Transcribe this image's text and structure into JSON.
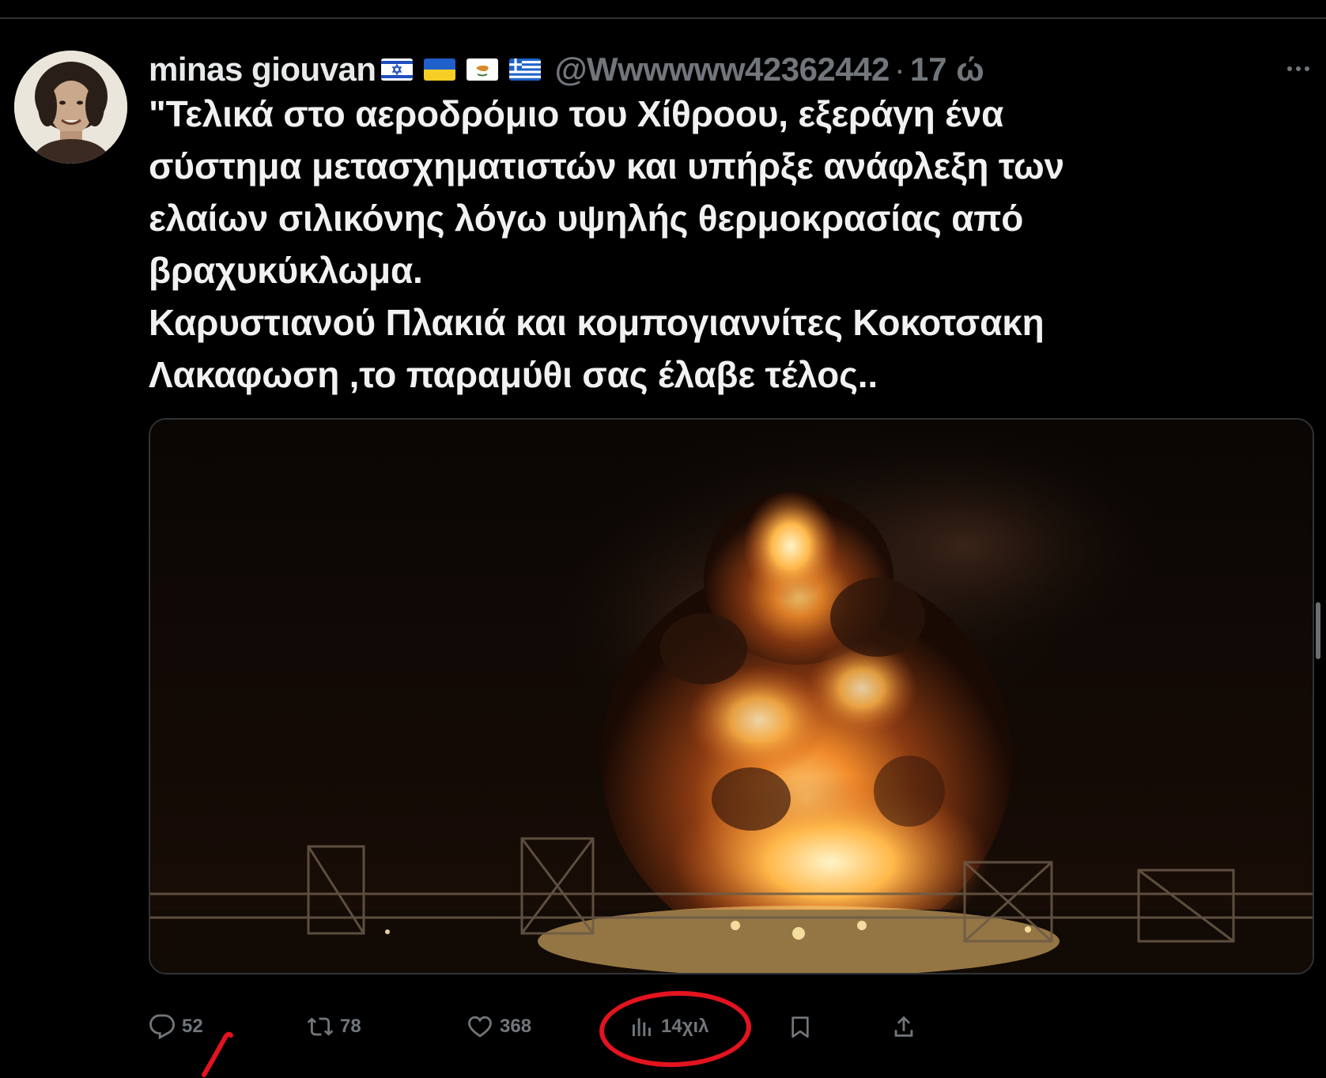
{
  "tweet": {
    "display_name": "minas giouvan",
    "flags": [
      "israel-flag",
      "ukraine-flag",
      "cyprus-flag",
      "greece-flag"
    ],
    "handle": "@Wwwwww42362442",
    "separator": "·",
    "timestamp": "17 ώ",
    "text": "\"Τελικά στο αεροδρόμιο του Χίθροου, εξεράγη ένα\nσύστημα μετασχηματιστών και υπήρξε ανάφλεξη των\nελαίων σιλικόνης λόγω υψηλής θερμοκρασίας από\nβραχυκύκλωμα.\nΚαρυστιανού Πλακιά και κομπογιαννίτες Κοκοτσακη\nΛακαφωση ,το παραμύθι σας έλαβε τέλος..",
    "more_icon": "more-horizontal-icon",
    "media": "photo of large fire with smoke at electrical substation at night"
  },
  "actions": {
    "replies": {
      "icon": "reply-icon",
      "count": "52"
    },
    "reposts": {
      "icon": "repost-icon",
      "count": "78"
    },
    "likes": {
      "icon": "heart-icon",
      "count": "368"
    },
    "views": {
      "icon": "analytics-icon",
      "count": "14χιλ"
    },
    "bookmark": {
      "icon": "bookmark-icon"
    },
    "share": {
      "icon": "share-icon"
    }
  },
  "annotation": {
    "color": "#e3141f",
    "target": "views"
  },
  "colors": {
    "background": "#000000",
    "text": "#e7e9ea",
    "secondary": "#71767b",
    "border": "#2f3336"
  }
}
